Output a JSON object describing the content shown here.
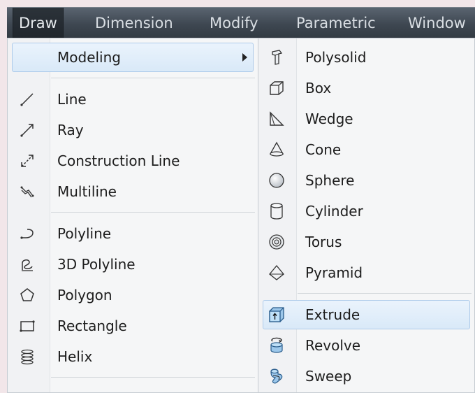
{
  "menubar": {
    "items": [
      "Draw",
      "Dimension",
      "Modify",
      "Parametric",
      "Window"
    ]
  },
  "draw_menu": {
    "items": [
      {
        "label": "Modeling",
        "icon": null,
        "submenu": true,
        "highlighted": true
      },
      {
        "label": "Line",
        "icon": "line-icon"
      },
      {
        "label": "Ray",
        "icon": "ray-icon"
      },
      {
        "label": "Construction Line",
        "icon": "construction-line-icon"
      },
      {
        "label": "Multiline",
        "icon": "multiline-icon"
      },
      {
        "label": "Polyline",
        "icon": "polyline-icon"
      },
      {
        "label": "3D Polyline",
        "icon": "3d-polyline-icon"
      },
      {
        "label": "Polygon",
        "icon": "polygon-icon"
      },
      {
        "label": "Rectangle",
        "icon": "rectangle-icon"
      },
      {
        "label": "Helix",
        "icon": "helix-icon"
      }
    ]
  },
  "modeling_menu": {
    "items": [
      {
        "label": "Polysolid",
        "icon": "polysolid-icon"
      },
      {
        "label": "Box",
        "icon": "box-icon"
      },
      {
        "label": "Wedge",
        "icon": "wedge-icon"
      },
      {
        "label": "Cone",
        "icon": "cone-icon"
      },
      {
        "label": "Sphere",
        "icon": "sphere-icon"
      },
      {
        "label": "Cylinder",
        "icon": "cylinder-icon"
      },
      {
        "label": "Torus",
        "icon": "torus-icon"
      },
      {
        "label": "Pyramid",
        "icon": "pyramid-icon"
      },
      {
        "label": "Extrude",
        "icon": "extrude-icon",
        "highlighted": true
      },
      {
        "label": "Revolve",
        "icon": "revolve-icon"
      },
      {
        "label": "Sweep",
        "icon": "sweep-icon"
      }
    ]
  },
  "colors": {
    "menubar_bg": "#3e4751",
    "menubar_text": "#d9dee3",
    "highlight_bg": "#d9e9f8",
    "highlight_border": "#aecbea",
    "menu_bg": "#f5f6f7"
  }
}
